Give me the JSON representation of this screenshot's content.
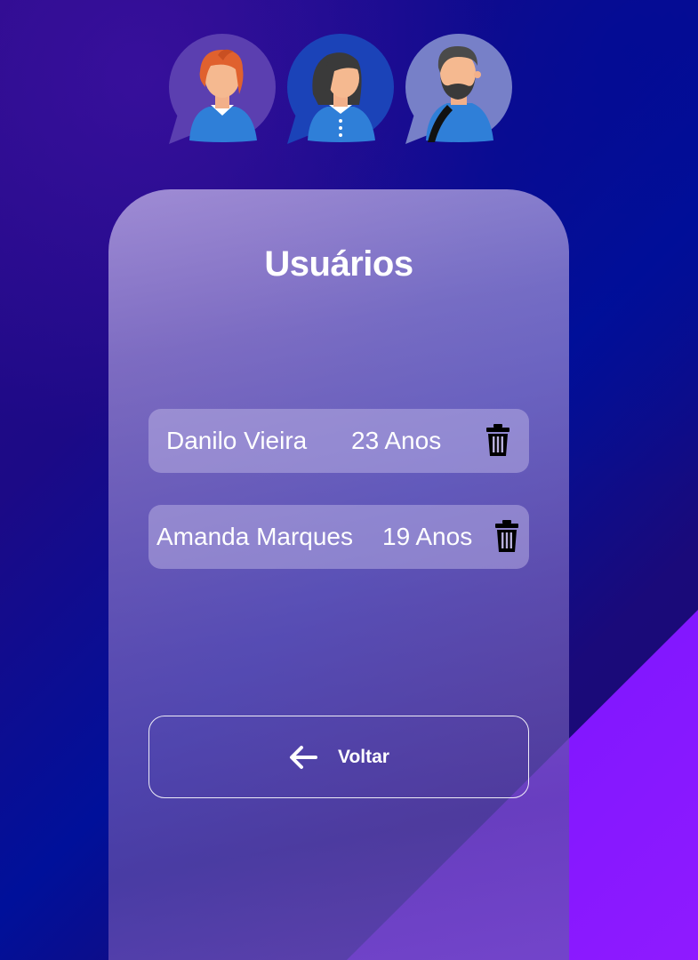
{
  "page": {
    "title": "Usuários"
  },
  "avatars": [
    {
      "icon": "avatar-woman-redhead-icon"
    },
    {
      "icon": "avatar-woman-dark-hair-icon"
    },
    {
      "icon": "avatar-man-beard-icon"
    }
  ],
  "users": [
    {
      "name": "Danilo Vieira",
      "age": "23 Anos",
      "delete_icon": "trash-icon"
    },
    {
      "name": "Amanda Marques",
      "age": "19 Anos",
      "delete_icon": "trash-icon"
    }
  ],
  "back_button": {
    "label": "Voltar",
    "icon": "arrow-left-icon"
  },
  "colors": {
    "background_start": "#2a0a8a",
    "background_mid": "#00109a",
    "accent_triangle": "#6f12ff",
    "card": "#a196d8",
    "row": "#c8bee8",
    "text": "#ffffff"
  }
}
